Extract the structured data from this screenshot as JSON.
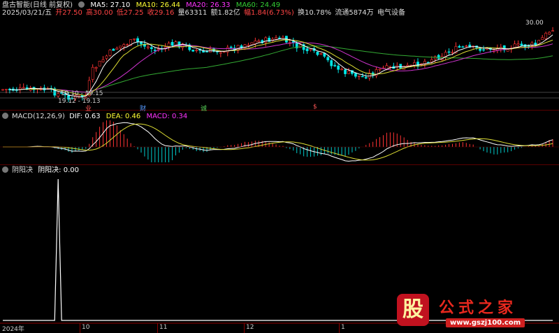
{
  "header": {
    "title": "盘古智能(日线 前复权)",
    "ma": [
      {
        "label": "MA5: 27.10",
        "color": "#ffffff"
      },
      {
        "label": "MA10: 26.44",
        "color": "#ffff33"
      },
      {
        "label": "MA20: 26.33",
        "color": "#ff33ff"
      },
      {
        "label": "MA60: 24.49",
        "color": "#33cc33"
      }
    ]
  },
  "quote": {
    "date": "2025/03/21/五",
    "open": "开27.50",
    "high": "高30.00",
    "low": "低27.25",
    "close": "收29.16",
    "volume": "量63311",
    "amount": "额1.82亿",
    "change": "幅1.84(6.73%)",
    "turnover": "换10.78%",
    "float": "流通5874万",
    "sector": "电气设备"
  },
  "price_annotations": {
    "high_label": "30.00",
    "range1": "19.10 - 19.15",
    "range2": "19.12 - 19.13"
  },
  "event_markers": [
    {
      "text": "业",
      "color": "#ff5555"
    },
    {
      "text": "财",
      "color": "#5599ff"
    },
    {
      "text": "诚",
      "color": "#55cc55"
    },
    {
      "text": "$",
      "color": "#ff5555"
    }
  ],
  "macd": {
    "name": "MACD(12,26,9)",
    "dif": "DIF: 0.63",
    "dea": "DEA: 0.46",
    "macd": "MACD: 0.34",
    "colors": {
      "dif": "#ffffff",
      "dea": "#ffff33",
      "macd": "#ff33ff"
    }
  },
  "yinyang": {
    "name": "阴阳决",
    "value_label": "阴阳决: 0.00"
  },
  "xaxis": {
    "labels": [
      "2024年",
      "10",
      "11",
      "12",
      "1"
    ]
  },
  "watermark": {
    "gu": "股",
    "title": "公式之家",
    "url": "www.gszj100.com"
  },
  "colors": {
    "up": "#ff3333",
    "down": "#00ffff",
    "ma5": "#ffffff",
    "ma10": "#ffff33",
    "ma20": "#cc33cc",
    "ma60": "#33aa33",
    "grid": "#5a0000"
  }
}
